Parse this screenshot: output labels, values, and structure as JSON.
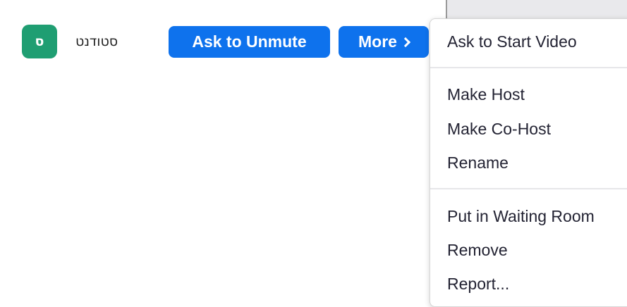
{
  "participant": {
    "avatar_initial": "ס",
    "name": "סטודנט"
  },
  "buttons": {
    "ask_to_unmute": "Ask to Unmute",
    "more": "More"
  },
  "context_menu": {
    "items": [
      "Ask to Start Video",
      "Make Host",
      "Make Co-Host",
      "Rename",
      "Put in Waiting Room",
      "Remove",
      "Report..."
    ]
  },
  "colors": {
    "avatar": "#1f9e72",
    "button": "#0e72ed",
    "menu_text": "#232333",
    "separator": "#e6e6e9"
  },
  "icons": {
    "more_chevron": "chevron-right-icon"
  }
}
